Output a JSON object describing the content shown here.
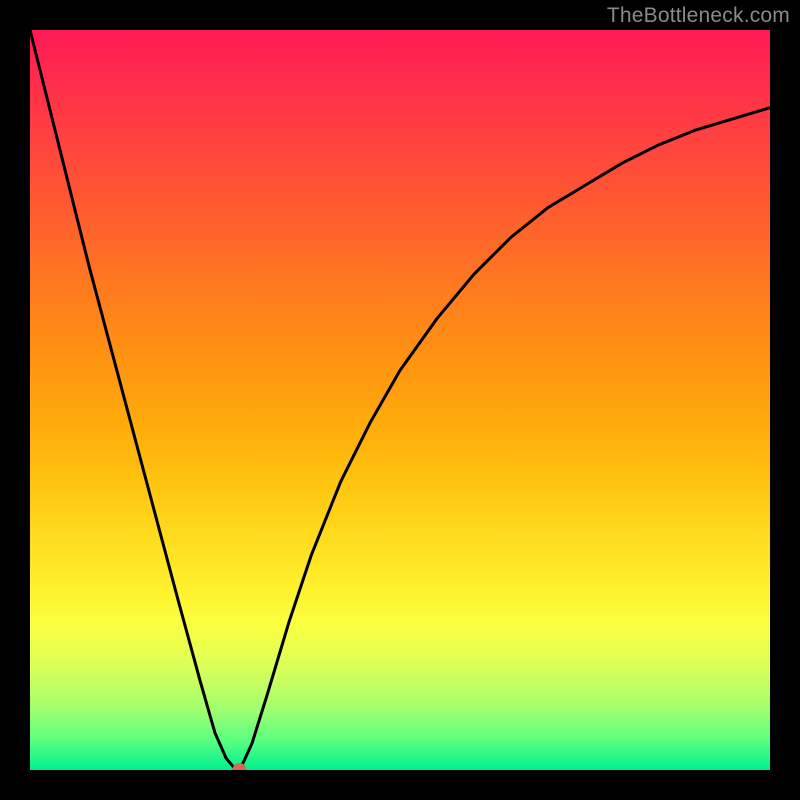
{
  "watermark": "TheBottleneck.com",
  "chart_data": {
    "type": "line",
    "title": "",
    "xlabel": "",
    "ylabel": "",
    "xlim": [
      0,
      100
    ],
    "ylim": [
      0,
      100
    ],
    "grid": false,
    "series": [
      {
        "name": "curve",
        "x": [
          0,
          4,
          8,
          12,
          16,
          20,
          23,
          25,
          26.5,
          27.5,
          28.3,
          29,
          30,
          32,
          35,
          38,
          42,
          46,
          50,
          55,
          60,
          65,
          70,
          75,
          80,
          85,
          90,
          95,
          100
        ],
        "y": [
          100,
          84,
          68,
          53,
          38,
          23,
          12,
          5,
          1.6,
          0.4,
          0,
          1.4,
          3.6,
          10,
          20,
          29,
          39,
          47,
          54,
          61,
          67,
          72,
          76,
          79,
          82,
          84.5,
          86.5,
          88,
          89.5
        ]
      }
    ],
    "marker": {
      "x": 28.3,
      "y": 0,
      "color": "#d66a52"
    },
    "gradient_stops": [
      {
        "pos": 0,
        "color": "#ff1a55"
      },
      {
        "pos": 14,
        "color": "#ff4040"
      },
      {
        "pos": 34,
        "color": "#ff7820"
      },
      {
        "pos": 54,
        "color": "#ffad0a"
      },
      {
        "pos": 70,
        "color": "#ffe020"
      },
      {
        "pos": 80,
        "color": "#fbff3e"
      },
      {
        "pos": 92,
        "color": "#9cff70"
      },
      {
        "pos": 100,
        "color": "#00f090"
      }
    ]
  }
}
